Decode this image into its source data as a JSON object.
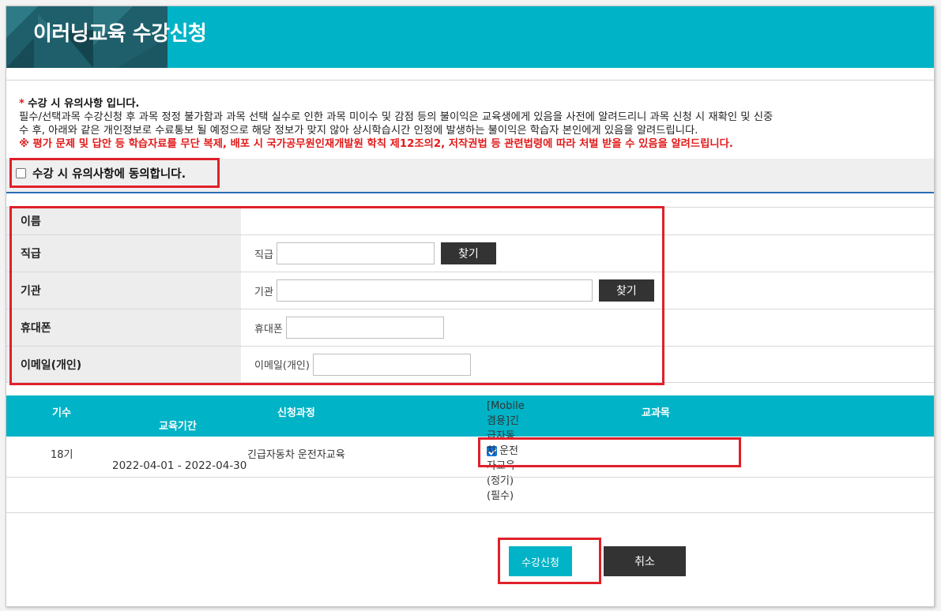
{
  "header": {
    "title": "이러닝교육 수강신청"
  },
  "notice": {
    "marker": "*",
    "title": "수강 시 유의사항 입니다.",
    "line1": "필수/선택과목 수강신청 후 과목 정정 불가함과 과목 선택 실수로 인한 과목 미이수 및 감점 등의 불이익은 교육생에게 있음을 사전에 알려드리니 과목 신청 시 재확인 및 신중",
    "line2": "수 후, 아래와 같은 개인정보로 수료통보 될 예정으로 해당 정보가 맞지 않아 상시학습시간 인정에 발생하는 불이익은 학습자 본인에게 있음을 알려드립니다.",
    "warning": "※ 평가 문제 및 답안 등 학습자료를 무단 복제, 배포 시 국가공무원인재개발원 학칙 제12조의2, 저작권법 등 관련법령에 따라 처벌 받을 수 있음을 알려드립니다."
  },
  "agree": {
    "label": "수강 시 유의사항에 동의합니다.",
    "checked": false
  },
  "form": {
    "name": {
      "label": "이름"
    },
    "rank": {
      "label": "직급",
      "field_label": "직급",
      "button": "찾기"
    },
    "agency": {
      "label": "기관",
      "field_label": "기관",
      "button": "찾기"
    },
    "phone": {
      "label": "휴대폰",
      "field_label": "휴대폰"
    },
    "email": {
      "label": "이메일(개인)",
      "field_label": "이메일(개인)"
    }
  },
  "table": {
    "headers": {
      "term": "기수",
      "period": "교육기간",
      "course": "신청과정",
      "subject": "교과목"
    },
    "rows": [
      {
        "term": "18기",
        "period": "2022-04-01 - 2022-04-30",
        "course": "긴급자동차 운전자교육",
        "subject": "[Mobile 겸용]긴급자동차 운전자교육(정기)(필수)",
        "subject_checked": true
      }
    ]
  },
  "buttons": {
    "apply": "수강신청",
    "cancel": "취소"
  },
  "colors": {
    "accent": "#00b3c6",
    "highlight": "#e0202a",
    "dark_button": "#333333"
  }
}
